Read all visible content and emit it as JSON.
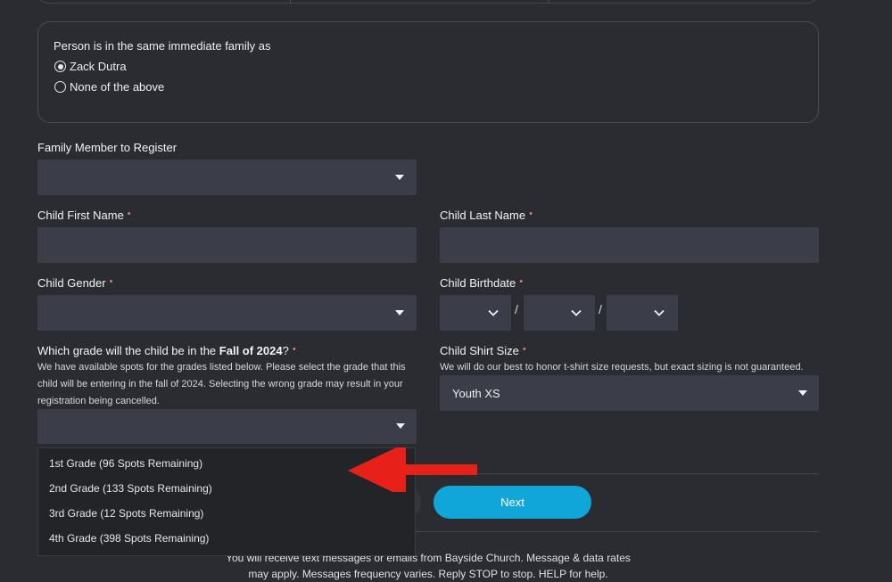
{
  "family_box": {
    "title": "Person is in the same immediate family as",
    "options": [
      {
        "label": "Zack Dutra",
        "checked": true
      },
      {
        "label": "None of the above",
        "checked": false
      }
    ]
  },
  "family_member": {
    "label": "Family Member to Register",
    "value": ""
  },
  "child_first_name": {
    "label": "Child First Name",
    "required": "•",
    "value": ""
  },
  "child_last_name": {
    "label": "Child Last Name",
    "required": "•",
    "value": ""
  },
  "child_gender": {
    "label": "Child Gender",
    "required": "•",
    "value": ""
  },
  "child_birthdate": {
    "label": "Child Birthdate",
    "required": "•",
    "separator": "/"
  },
  "grade": {
    "label_prefix": "Which grade will the child be in the ",
    "label_bold": "Fall of 2024",
    "label_suffix": "?",
    "required": "•",
    "help_lines": [
      "We have available spots for the grades listed below. Please select the grade that this",
      "child will be entering in the fall of 2024. Selecting the wrong grade may result in your",
      "registration being cancelled."
    ],
    "options": [
      "1st Grade (96 Spots Remaining)",
      "2nd Grade (133 Spots Remaining)",
      "3rd Grade (12 Spots Remaining)",
      "4th Grade (398 Spots Remaining)"
    ]
  },
  "shirt_size": {
    "label": "Child Shirt Size",
    "required": "•",
    "help": "We will do our best to honor t-shirt size requests, but exact sizing is not guaranteed.",
    "value": "Youth XS"
  },
  "next_button": "Next",
  "footer_lines": [
    "You will receive text messages or emails from Bayside Church. Message & data rates",
    "may apply. Messages frequency varies. Reply STOP to stop. HELP for help."
  ],
  "colors": {
    "accent": "#10a6da",
    "arrow": "#e8201a",
    "field": "#3b3e49",
    "background": "#2b2c31"
  }
}
